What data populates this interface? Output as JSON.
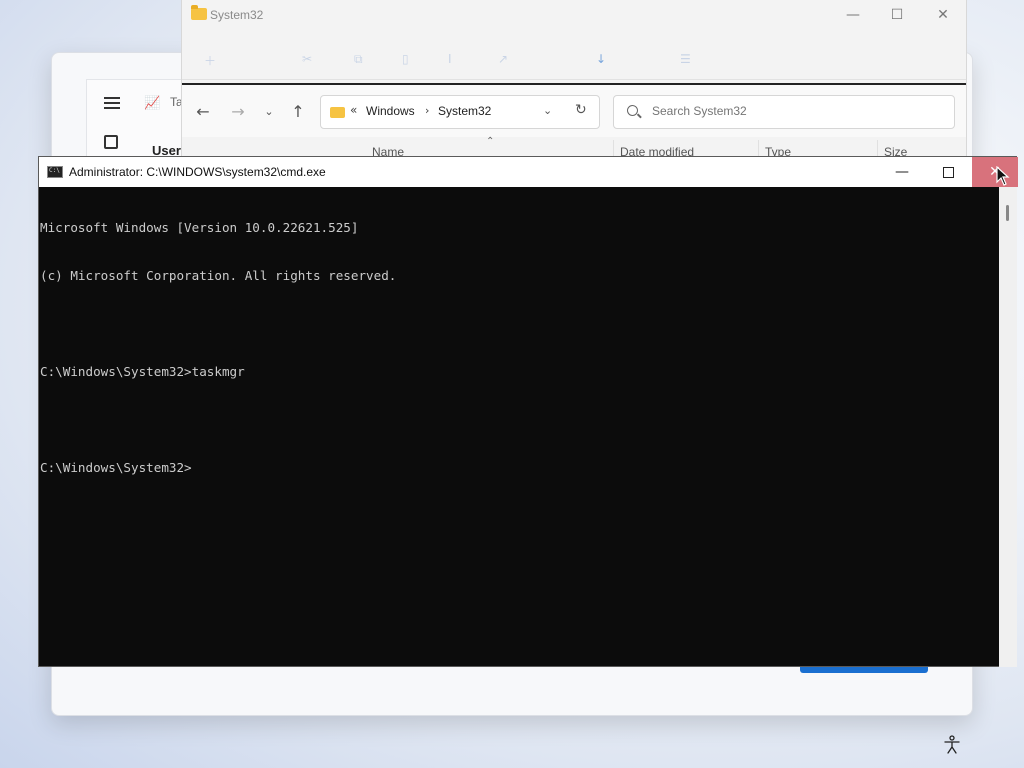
{
  "background_window": {
    "tab_partial": "Ta",
    "section_title": "Users"
  },
  "explorer": {
    "title": "System32",
    "window_controls": {
      "minimize": "—",
      "maximize": "☐",
      "close": "✕"
    },
    "breadcrumb": [
      "Windows",
      "System32"
    ],
    "breadcrumb_prefix": "«",
    "search_placeholder": "Search System32",
    "columns": [
      "Name",
      "Date modified",
      "Type",
      "Size"
    ]
  },
  "cmd": {
    "title": "Administrator: C:\\WINDOWS\\system32\\cmd.exe",
    "controls": {
      "minimize": "—",
      "close": "✕"
    },
    "lines": [
      "Microsoft Windows [Version 10.0.22621.525]",
      "(c) Microsoft Corporation. All rights reserved.",
      "",
      "C:\\Windows\\System32>taskmgr",
      "",
      "C:\\Windows\\System32>"
    ]
  },
  "colors": {
    "cmd_background": "#0c0c0c",
    "cmd_text": "#cccccc",
    "close_hover": "#d8727c",
    "accent_blue": "#1a6fd0",
    "folder_yellow": "#f6c342"
  },
  "icons": [
    "folder-icon",
    "back-arrow-icon",
    "forward-arrow-icon",
    "chevron-down-icon",
    "up-arrow-icon",
    "refresh-icon",
    "search-icon",
    "cmd-icon",
    "mouse-pointer-icon",
    "accessibility-icon",
    "hamburger-icon",
    "apps-icon"
  ]
}
